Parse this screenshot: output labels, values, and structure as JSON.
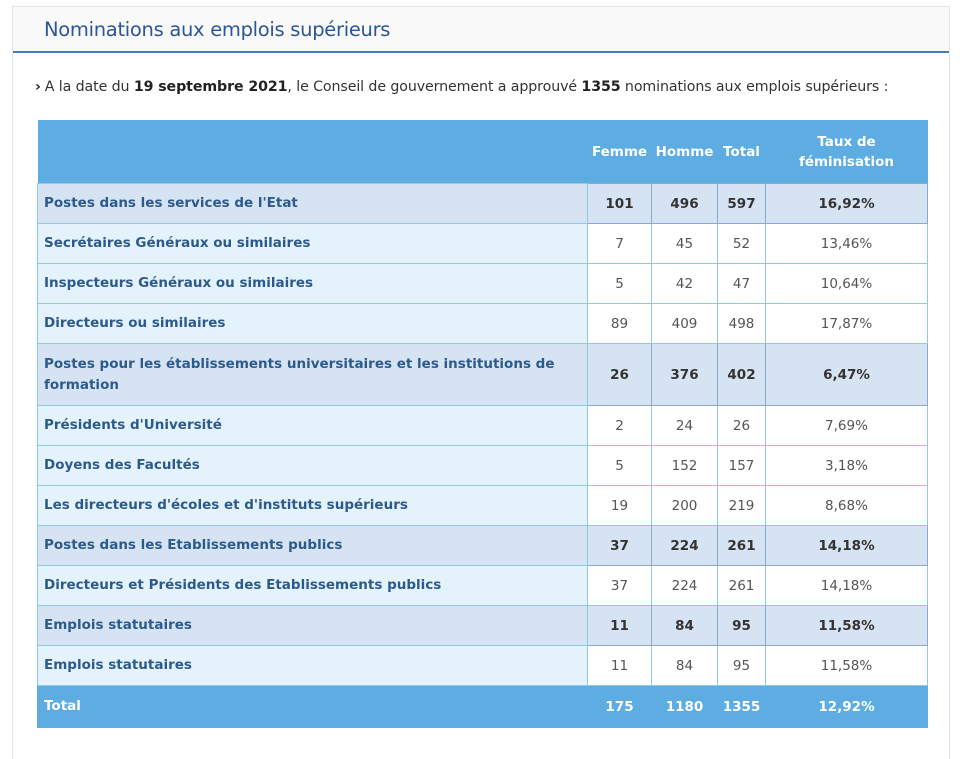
{
  "panel": {
    "title": "Nominations aux emplois supérieurs"
  },
  "intro": {
    "chevron": "›",
    "prefix": "A la date du ",
    "date": "19 septembre 2021",
    "middle": ", le Conseil de gouvernement a approuvé ",
    "count": "1355",
    "suffix": " nominations aux emplois supérieurs :"
  },
  "table": {
    "headers": [
      "",
      "Femme",
      "Homme",
      "Total",
      "Taux de féminisation"
    ],
    "rows": [
      {
        "label": "Postes dans les services de l'Etat",
        "femme": "101",
        "homme": "496",
        "total": "597",
        "taux": "16,92%"
      },
      {
        "label": "Secrétaires Généraux ou similaires",
        "femme": "7",
        "homme": "45",
        "total": "52",
        "taux": "13,46%"
      },
      {
        "label": "Inspecteurs Généraux ou similaires",
        "femme": "5",
        "homme": "42",
        "total": "47",
        "taux": "10,64%"
      },
      {
        "label": "Directeurs ou similaires",
        "femme": "89",
        "homme": "409",
        "total": "498",
        "taux": "17,87%"
      },
      {
        "label": "Postes pour les établissements universitaires et les institutions de formation",
        "femme": "26",
        "homme": "376",
        "total": "402",
        "taux": "6,47%"
      },
      {
        "label": "Présidents d'Université",
        "femme": "2",
        "homme": "24",
        "total": "26",
        "taux": "7,69%"
      },
      {
        "label": "Doyens des Facultés",
        "femme": "5",
        "homme": "152",
        "total": "157",
        "taux": "3,18%"
      },
      {
        "label": "Les directeurs d'écoles et d'instituts supérieurs",
        "femme": "19",
        "homme": "200",
        "total": "219",
        "taux": "8,68%"
      },
      {
        "label": "Postes dans les Etablissements publics",
        "femme": "37",
        "homme": "224",
        "total": "261",
        "taux": "14,18%"
      },
      {
        "label": "Directeurs et Présidents des Etablissements publics",
        "femme": "37",
        "homme": "224",
        "total": "261",
        "taux": "14,18%"
      },
      {
        "label": "Emplois statutaires",
        "femme": "11",
        "homme": "84",
        "total": "95",
        "taux": "11,58%"
      },
      {
        "label": "Emplois statutaires",
        "femme": "11",
        "homme": "84",
        "total": "95",
        "taux": "11,58%"
      }
    ],
    "total_row": {
      "label": "Total",
      "femme": "175",
      "homme": "1180",
      "total": "1355",
      "taux": "12,92%"
    }
  },
  "colors": {
    "header_blue": "#5dade2",
    "title_blue": "#2b5797",
    "group_row": "#d6e3f3",
    "label_cell": "#e4f2fb"
  }
}
